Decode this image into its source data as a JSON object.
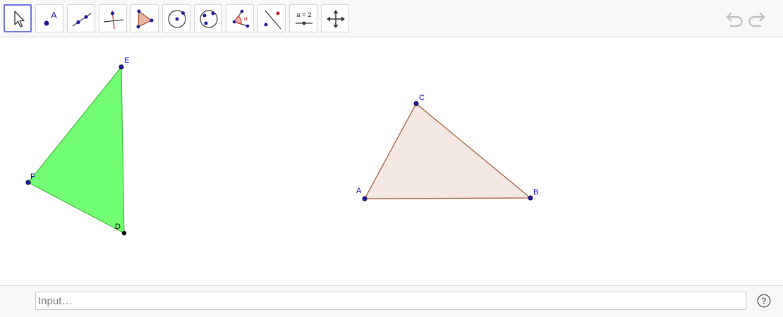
{
  "toolbar": {
    "tools": [
      {
        "name": "move-tool",
        "icon": "arrow-pointer-icon",
        "active": true
      },
      {
        "name": "point-tool",
        "icon": "point-icon",
        "glyph": "A"
      },
      {
        "name": "line-tool",
        "icon": "line-through-points-icon"
      },
      {
        "name": "perpendicular-line-tool",
        "icon": "perpendicular-line-icon"
      },
      {
        "name": "polygon-tool",
        "icon": "polygon-icon"
      },
      {
        "name": "circle-tool",
        "icon": "circle-center-point-icon"
      },
      {
        "name": "conic-tool",
        "icon": "circle-three-points-icon"
      },
      {
        "name": "angle-tool",
        "icon": "angle-icon",
        "glyph": "α"
      },
      {
        "name": "reflect-tool",
        "icon": "reflect-about-line-icon"
      },
      {
        "name": "slider-tool",
        "icon": "slider-icon",
        "glyph": "a = 2"
      },
      {
        "name": "move-graphics-view-tool",
        "icon": "move-graphics-view-icon"
      }
    ],
    "undo_icon": "undo-icon",
    "redo_icon": "redo-icon"
  },
  "graphics": {
    "triangles": [
      {
        "name": "triangle-def",
        "fill": "#00ff00",
        "fill_opacity": 0.55,
        "stroke": "#33aa33",
        "vertices": [
          "D",
          "E",
          "F"
        ]
      },
      {
        "name": "triangle-abc",
        "fill": "#e9d2c8",
        "fill_opacity": 0.5,
        "stroke": "#a0522d",
        "vertices": [
          "A",
          "B",
          "C"
        ]
      }
    ],
    "points": [
      {
        "label": "E",
        "color": "#1a1aaa"
      },
      {
        "label": "F",
        "color": "#1a1aaa"
      },
      {
        "label": "D",
        "color": "#000000"
      },
      {
        "label": "C",
        "color": "#1a1aaa"
      },
      {
        "label": "A",
        "color": "#1a1aaa"
      },
      {
        "label": "B",
        "color": "#1a1aaa"
      }
    ]
  },
  "algebra_input": {
    "placeholder": "Input…",
    "value": ""
  },
  "help_icon": "help-circle-icon",
  "help_glyph": "?"
}
